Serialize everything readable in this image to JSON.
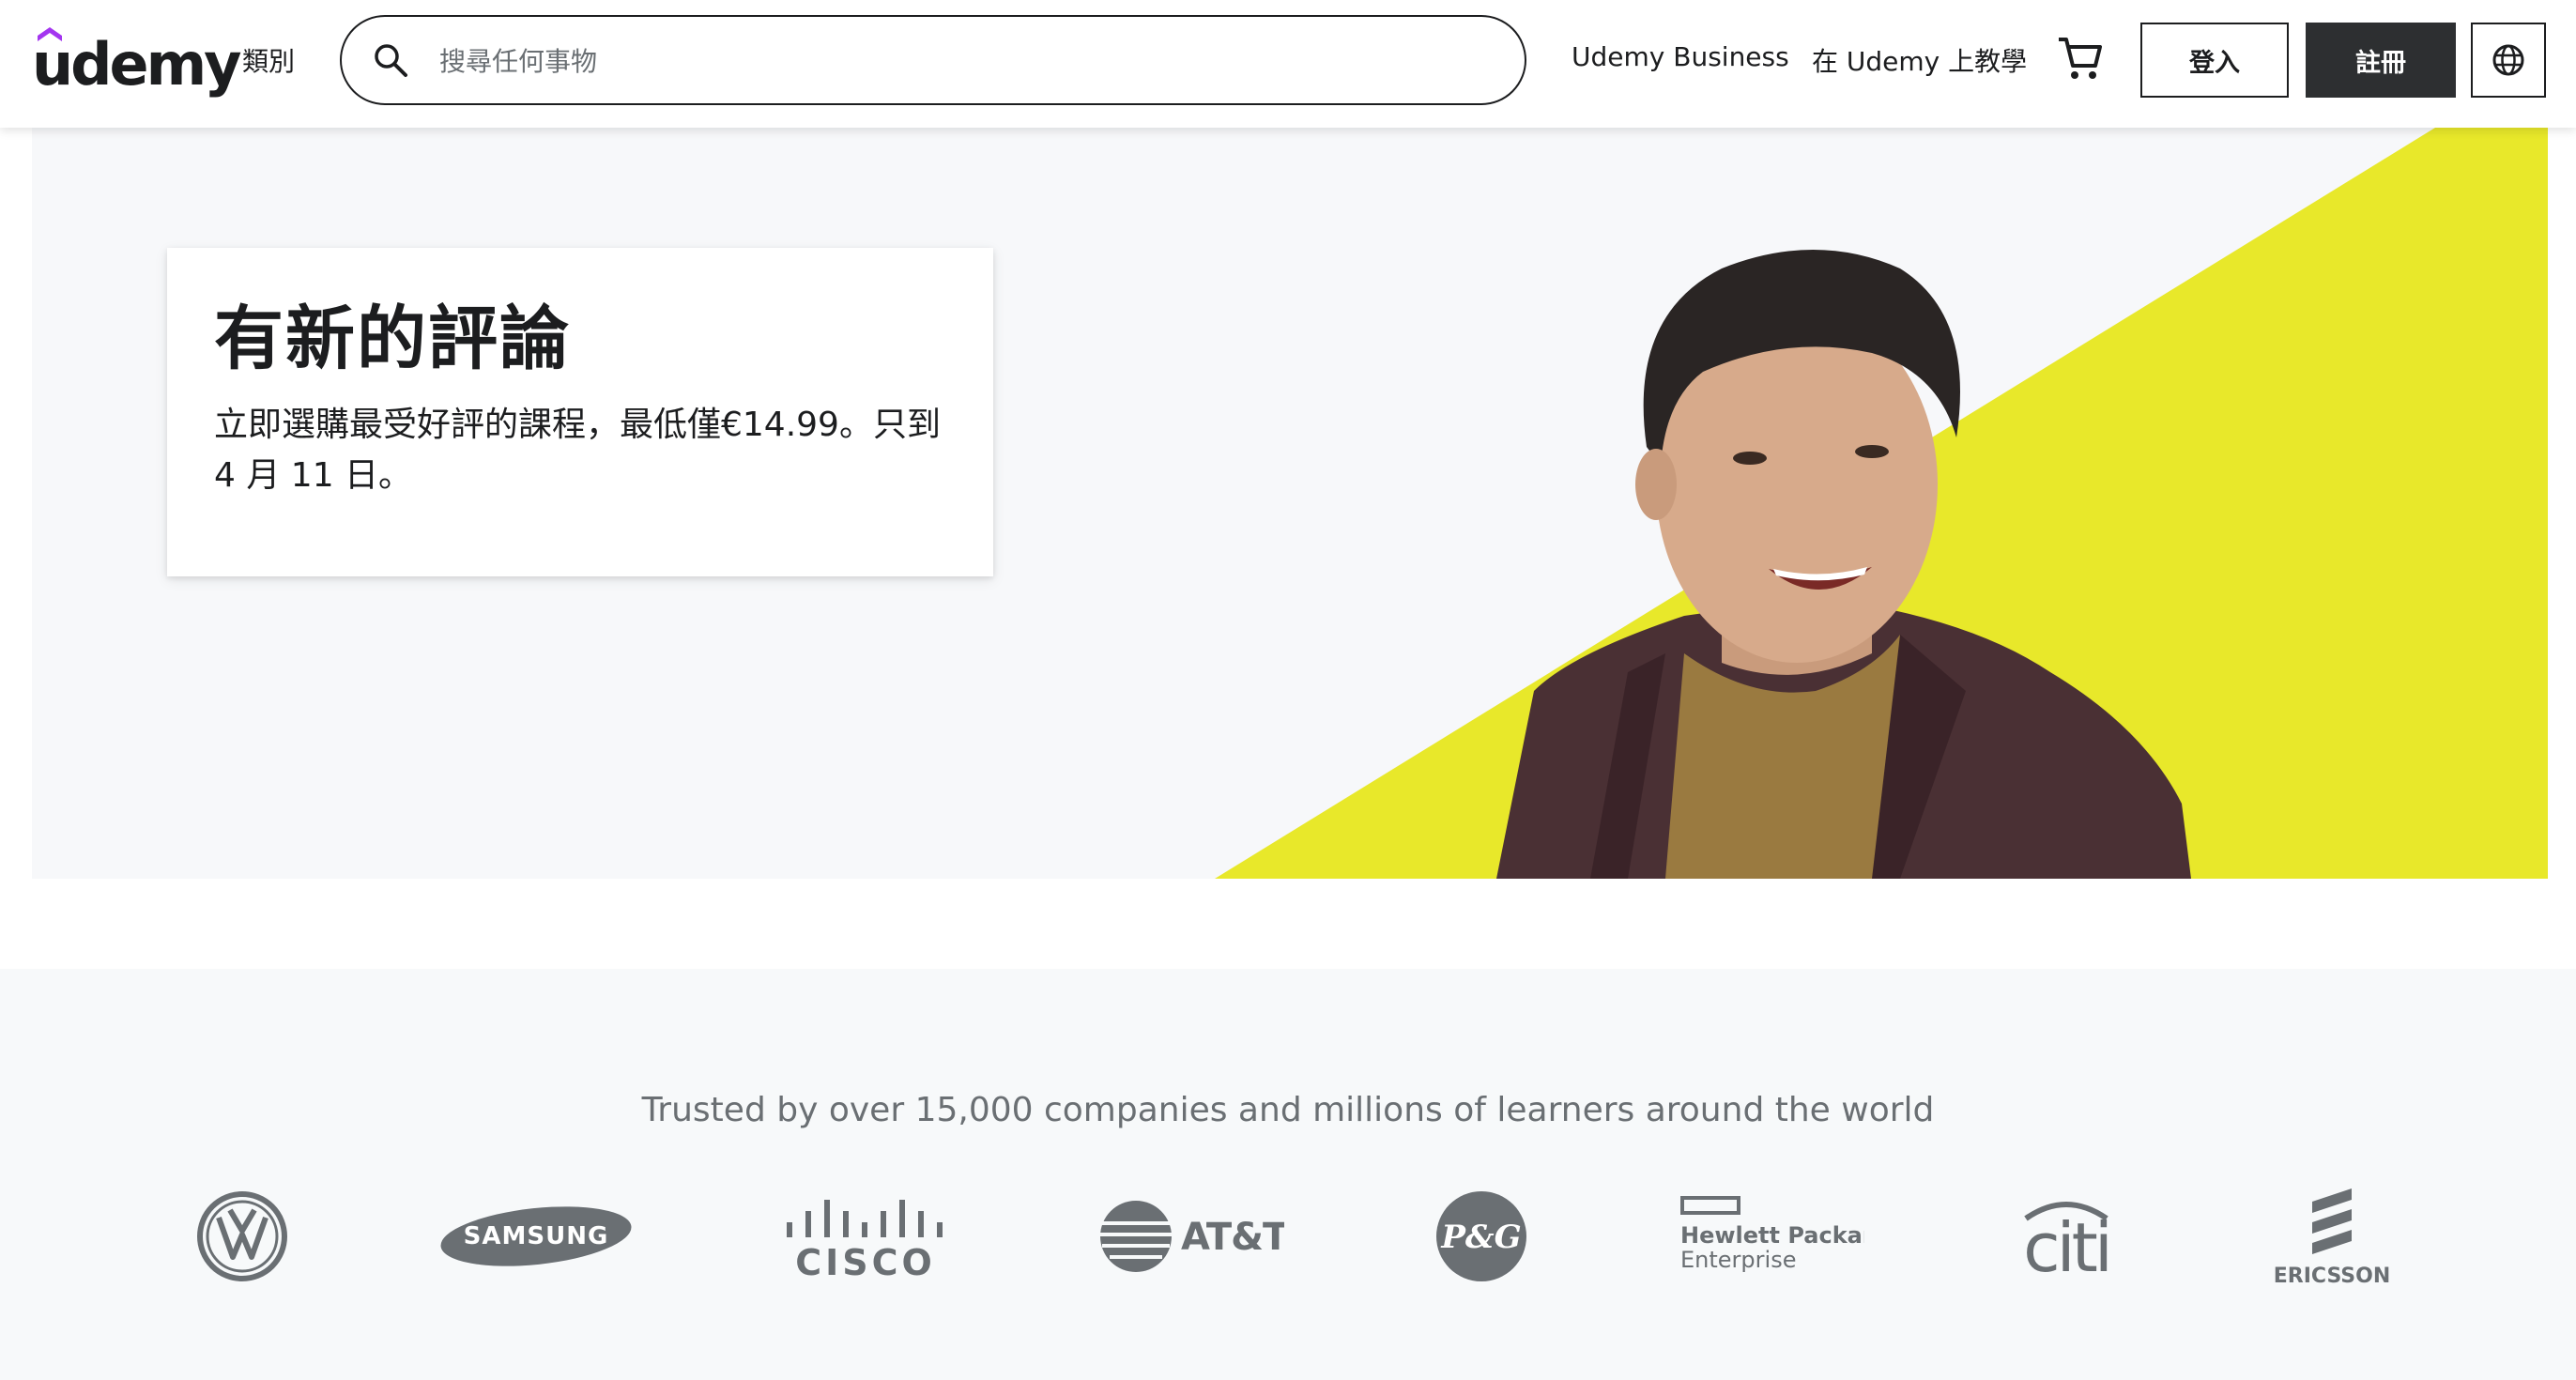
{
  "header": {
    "logo_text": "udemy",
    "categories_label": "類別",
    "search": {
      "placeholder": "搜尋任何事物",
      "value": ""
    },
    "business_link": "Udemy Business",
    "teach_link": "在 Udemy 上教學",
    "login_label": "登入",
    "signup_label": "註冊",
    "icons": [
      "search-icon",
      "cart-icon",
      "globe-icon"
    ]
  },
  "hero": {
    "title": "有新的評論",
    "text": "立即選購最受好評的課程，最低僅€14.99。只到 4 月 11 日。",
    "accent_color": "#e8e82a",
    "background_color": "#f7f8fa"
  },
  "trusted": {
    "title": "Trusted by over 15,000 companies and millions of learners around the world",
    "logos": [
      {
        "name": "volkswagen"
      },
      {
        "name": "samsung",
        "text": "SAMSUNG"
      },
      {
        "name": "cisco",
        "text": "CISCO"
      },
      {
        "name": "att",
        "text": "AT&T"
      },
      {
        "name": "procter-gamble",
        "text": "P&G"
      },
      {
        "name": "hewlett-packard-enterprise",
        "text_line1": "Hewlett Packard",
        "text_line2": "Enterprise"
      },
      {
        "name": "citi",
        "text": "citi"
      },
      {
        "name": "ericsson",
        "text": "ERICSSON"
      }
    ]
  },
  "colors": {
    "brand_purple": "#a435f0",
    "dark": "#1c1d1f",
    "signup_bg": "#2d2f31",
    "muted_text": "#6a6f73"
  }
}
